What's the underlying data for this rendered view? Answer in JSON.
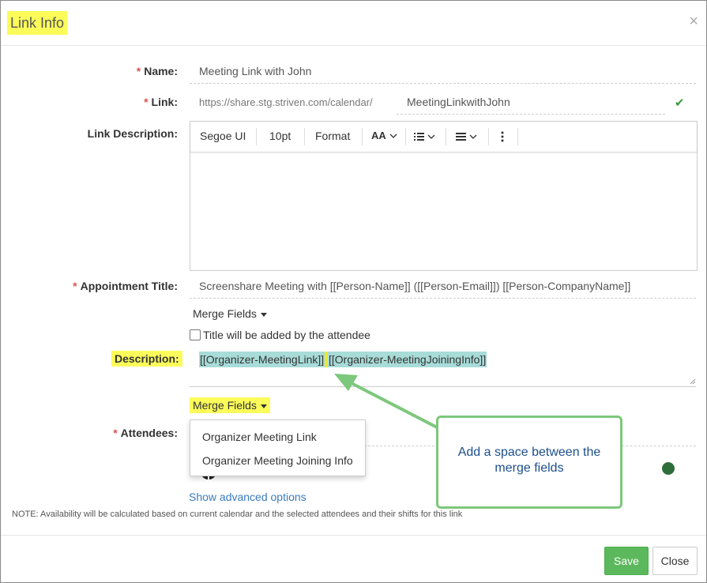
{
  "modal": {
    "title": "Link Info",
    "close_glyph": "×"
  },
  "form": {
    "required_marker": "*",
    "name": {
      "label": "Name:",
      "value": "Meeting Link with John"
    },
    "link": {
      "label": "Link:",
      "prefix": "https://share.stg.striven.com/calendar/",
      "value": "MeetingLinkwithJohn",
      "check_glyph": "✔"
    },
    "link_description": {
      "label": "Link Description:",
      "toolbar": {
        "font": "Segoe UI",
        "size": "10pt",
        "format": "Format",
        "font_size_icon": "AA"
      }
    },
    "appointment_title": {
      "label": "Appointment Title:",
      "value": "Screenshare Meeting with [[Person-Name]] ([[Person-Email]]) [[Person-CompanyName]]",
      "merge_fields_label": "Merge Fields",
      "checkbox_label": "Title will be added by the attendee",
      "checkbox_checked": false
    },
    "description": {
      "label": "Description:",
      "token1": "[[Organizer-MeetingLink]]",
      "token2": "[[Organizer-MeetingJoiningInfo]]",
      "merge_fields_label": "Merge Fields"
    },
    "attendees": {
      "label": "Attendees:"
    },
    "merge_dropdown": {
      "items": [
        "Organizer Meeting Link",
        "Organizer Meeting Joining Info"
      ]
    },
    "advanced_link": "Show advanced options",
    "note": "NOTE: Availability will be calculated based on current calendar and the selected attendees and their shifts for this link"
  },
  "annotation": {
    "text": "Add a space between the merge fields",
    "colors": {
      "border": "#7dc87c",
      "text": "#1c4f8c",
      "highlight": "#fbfb5a"
    }
  },
  "footer": {
    "save_label": "Save",
    "close_label": "Close"
  },
  "colors": {
    "save": "#5cb85c",
    "required": "#d9534f",
    "token_bg": "#a8dcd8",
    "status_dot": "#2f6e3b"
  }
}
